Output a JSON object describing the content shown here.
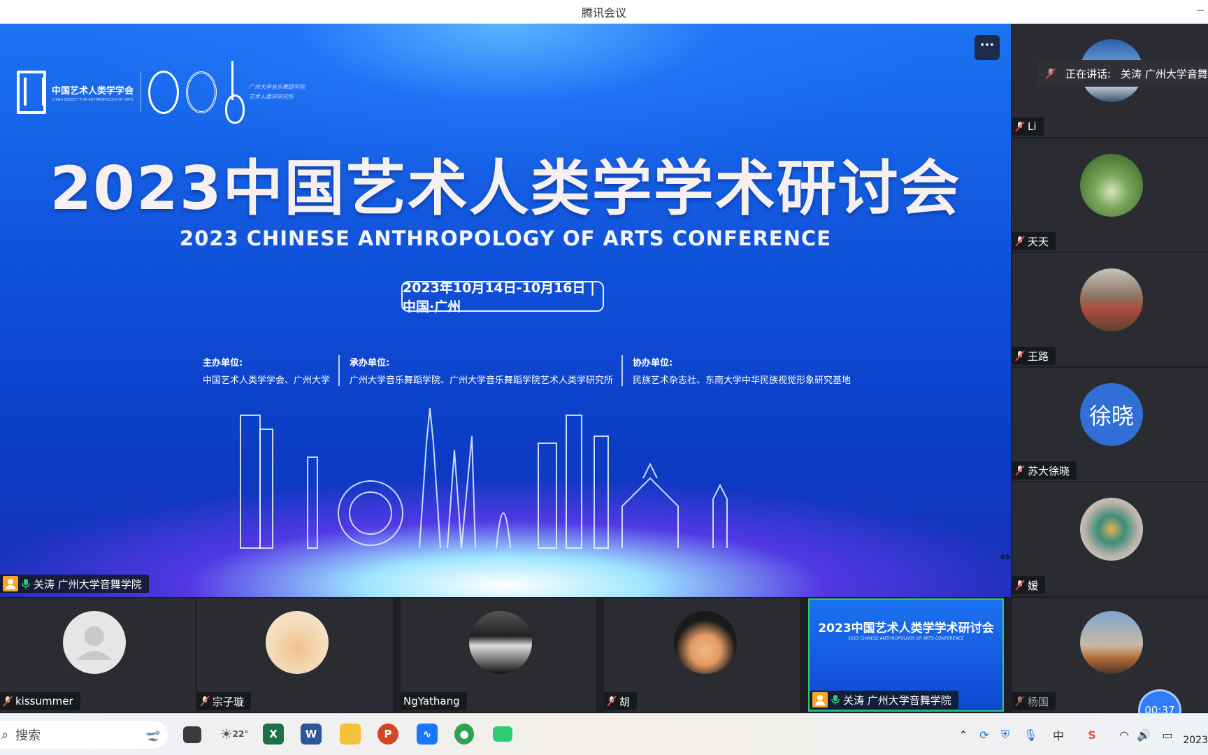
{
  "window": {
    "title": "腾讯会议"
  },
  "stage": {
    "more_label": "···",
    "logo": {
      "name": "中国艺术人类学学会",
      "subtitle": "CHINA SOCIETY FOR ANTHROPOLOGY OF ARTS"
    },
    "script_text": "广州大学音乐舞蹈学院 艺术人类学研究所",
    "main_title": "2023中国艺术人类学学术研讨会",
    "en_title": "2023 CHINESE ANTHROPOLOGY OF ARTS CONFERENCE",
    "date": "2023年10月14日-10月16日 | 中国·广州",
    "orgs": [
      {
        "head": "主办单位:",
        "body": "中国艺术人类学学会、广州大学"
      },
      {
        "head": "承办单位:",
        "body": "广州大学音乐舞蹈学院、广州大学音乐舞蹈学院艺术人类学研究所"
      },
      {
        "head": "协办单位:",
        "body": "民族艺术杂志社、东南大学中华民族视觉形象研究基地"
      }
    ],
    "presenter": "关涛 广州大学音舞学院"
  },
  "speaking": {
    "label": "正在讲话:",
    "name": "关涛 广州大学音舞学院"
  },
  "sidebar": [
    {
      "name": "Li",
      "avatar": "landscape"
    },
    {
      "name": "天天",
      "avatar": "plant"
    },
    {
      "name": "王路",
      "avatar": "photo-woman"
    },
    {
      "name": "苏大徐晓",
      "avatar": "text",
      "avatar_text": "徐晓",
      "avatar_color": "#2f6fd6"
    },
    {
      "name": "嫒",
      "avatar": "beads"
    },
    {
      "name": "杨国",
      "avatar": "sunset"
    }
  ],
  "bottom": [
    {
      "name": "kissummer",
      "avatar": "default"
    },
    {
      "name": "宗子璇",
      "avatar": "cartoon"
    },
    {
      "name": "NgYathang",
      "avatar": "bw-photo"
    },
    {
      "name": "胡",
      "avatar": "memoji"
    },
    {
      "name": "关涛 广州大学音舞学院",
      "avatar": "screen-share"
    }
  ],
  "timer": "00:37",
  "taskbar": {
    "search_placeholder": "搜索",
    "weather": "22°",
    "apps": [
      "file-explorer-icon",
      "excel-icon",
      "word-icon",
      "folder-icon",
      "powerpoint-icon",
      "photos-icon",
      "wechat-icon",
      "tencent-meeting-icon"
    ],
    "tray": [
      "chevron-up-icon",
      "sync-icon",
      "shield-icon",
      "microphone-icon",
      "ime-zh-icon",
      "sogou-icon",
      "wifi-icon",
      "volume-icon",
      "battery-icon"
    ],
    "ime_label": "中",
    "sogou_label": "S",
    "year": "2023"
  }
}
